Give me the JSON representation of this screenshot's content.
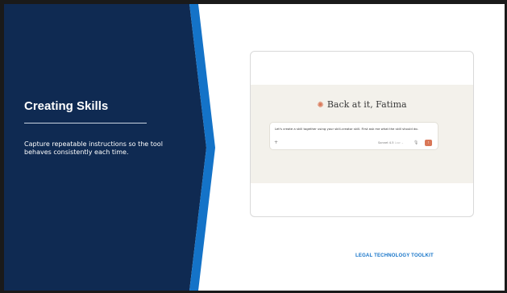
{
  "slide": {
    "title": "Creating Skills",
    "subtitle": "Capture repeatable instructions so the tool behaves consistently each time.",
    "footer": "LEGAL TECHNOLOGY TOOLKIT"
  },
  "screenshot": {
    "greeting": "Back at it, Fatima",
    "greeting_icon": "spark-icon",
    "prompt_text": "Let's create a skill together using your skill-creator skill. First ask me what the skill should do.",
    "add_icon_glyph": "+",
    "model_name": "Sonnet 4.5",
    "model_suffix": "Low ⌄",
    "mic_icon": "mic-icon",
    "send_icon": "send-arrow-icon"
  },
  "colors": {
    "left_panel": "#0f2a52",
    "chevron": "#1473c8",
    "footer_text": "#1473c8",
    "accent_orange": "#d97757",
    "screenshot_band": "#f3f1eb"
  }
}
